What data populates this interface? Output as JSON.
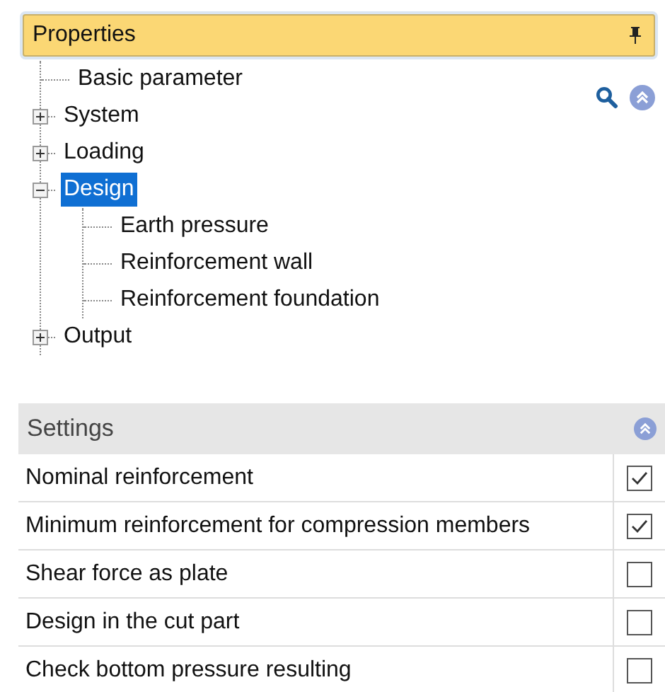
{
  "properties_panel": {
    "title": "Properties",
    "tree": [
      {
        "label": "Basic parameter",
        "selected": false
      },
      {
        "label": "System",
        "expanded": false,
        "selected": false
      },
      {
        "label": "Loading",
        "expanded": false,
        "selected": false
      },
      {
        "label": "Design",
        "expanded": true,
        "selected": true,
        "children": [
          {
            "label": "Earth pressure",
            "selected": false
          },
          {
            "label": "Reinforcement wall",
            "selected": false
          },
          {
            "label": "Reinforcement foundation",
            "selected": false
          }
        ]
      },
      {
        "label": "Output",
        "expanded": false,
        "selected": false
      }
    ]
  },
  "settings": {
    "title": "Settings",
    "rows": [
      {
        "label": "Nominal reinforcement",
        "checked": true
      },
      {
        "label": "Minimum reinforcement for compression members",
        "checked": true
      },
      {
        "label": "Shear force as plate",
        "checked": false
      },
      {
        "label": "Design in the cut part",
        "checked": false
      },
      {
        "label": "Check bottom pressure resulting",
        "checked": false
      }
    ]
  }
}
